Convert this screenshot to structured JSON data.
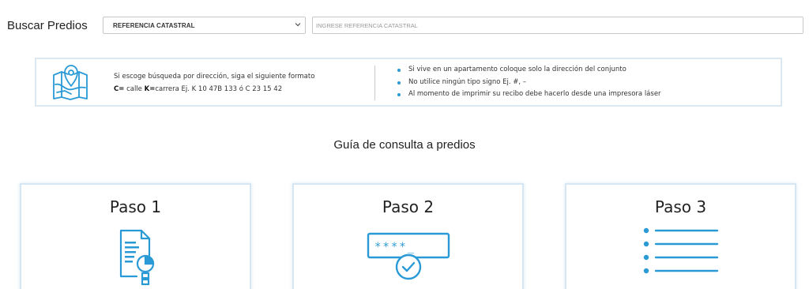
{
  "search": {
    "label": "Buscar Predios",
    "select_value": "REFERENCIA CATASTRAL",
    "input_placeholder": "INGRESE REFERENCIA CATASTRAL",
    "input_value": ""
  },
  "info": {
    "line1": "Si escoge búsqueda por dirección, siga el siguiente formato",
    "c_label": "C=",
    "c_text": " calle  ",
    "k_label": "K=",
    "k_text": "carrera   Ej. K 10 47B 133 ó C 23 15 42",
    "tips": [
      "Si vive en un apartamento coloque solo la dirección del conjunto",
      "No utilice ningún tipo signo Ej. #, –",
      "Al momento de imprimir su recibo debe hacerlo desde una impresora láser"
    ],
    "icon": "map-pin-icon"
  },
  "guide": {
    "title": "Guía de consulta a predios",
    "steps": [
      {
        "title": "Paso 1",
        "icon": "document-search-icon"
      },
      {
        "title": "Paso 2",
        "icon": "password-check-icon",
        "icon_text": "****_"
      },
      {
        "title": "Paso 3",
        "icon": "list-icon"
      }
    ]
  },
  "colors": {
    "accent": "#2a9ad6",
    "border": "#d6e6f3"
  }
}
